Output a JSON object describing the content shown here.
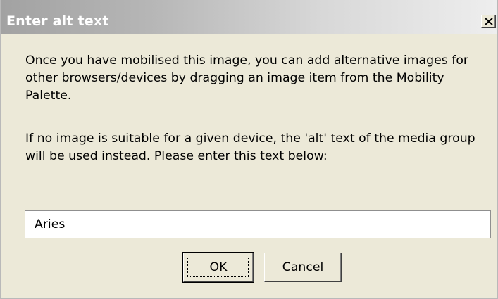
{
  "dialog": {
    "title": "Enter alt text",
    "close_icon": "close-x-icon",
    "message_paragraph_1": "Once you have mobilised this image, you can add alternative images for other browsers/devices by dragging an image item from the Mobility Palette.",
    "message_paragraph_2": "If no image is suitable for a given device, the 'alt' text of the media group will be used instead. Please enter this text below:",
    "alt_text_value": "Aries",
    "ok_label": "OK",
    "cancel_label": "Cancel"
  },
  "colors": {
    "dialog_background": "#ece9d8",
    "title_text": "#ffffff",
    "titlebar_start": "#a2a2a2",
    "titlebar_end": "#eeeeee"
  }
}
